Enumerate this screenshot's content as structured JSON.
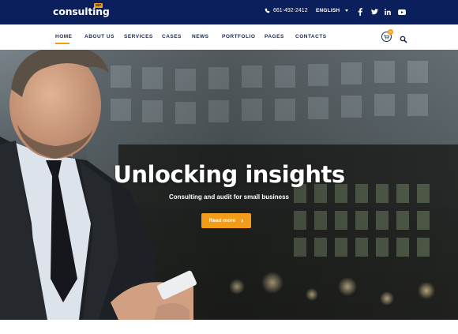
{
  "brand": {
    "name": "consulting",
    "badge": "WP"
  },
  "topbar": {
    "phone": "661-492-2412",
    "language": "ENGLISH",
    "social": [
      "facebook-icon",
      "twitter-icon",
      "linkedin-icon",
      "youtube-icon"
    ]
  },
  "nav": {
    "items": [
      "HOME",
      "ABOUT US",
      "SERVICES",
      "CASES",
      "NEWS",
      "PORTFOLIO",
      "PAGES",
      "CONTACTS"
    ],
    "active": "HOME",
    "cart_count": "0"
  },
  "hero": {
    "title": "Unlocking insights",
    "subtitle": "Consulting and audit for small business",
    "button_label": "Read more"
  },
  "colors": {
    "topbar": "#0b1f5c",
    "accent": "#f39c1a",
    "nav_text": "#1c2a4f"
  }
}
